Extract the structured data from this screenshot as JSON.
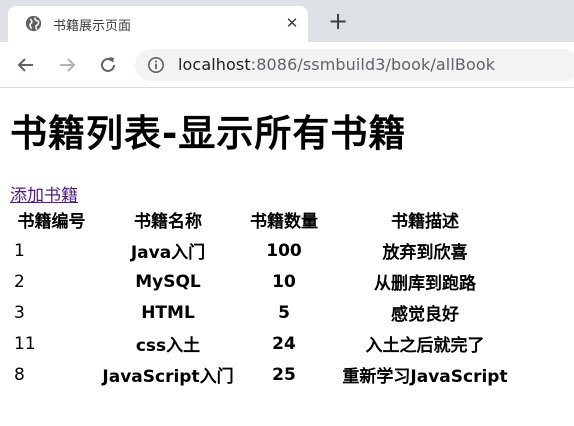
{
  "browser": {
    "tab_title": "书籍展示页面",
    "url_host": "localhost",
    "url_path": ":8086/ssmbuild3/book/allBook",
    "icons": {
      "favicon": "globe-icon",
      "close": "close-icon",
      "new_tab": "plus-icon",
      "back": "back-arrow-icon",
      "forward": "forward-arrow-icon",
      "reload": "reload-icon",
      "site_info": "info-icon"
    }
  },
  "page": {
    "heading": "书籍列表-显示所有书籍",
    "add_link": "添加书籍",
    "link_color": "#551a8b",
    "table": {
      "headers": [
        "书籍编号",
        "书籍名称",
        "书籍数量",
        "书籍描述"
      ],
      "rows": [
        [
          "1",
          "Java入门",
          "100",
          "放弃到欣喜"
        ],
        [
          "2",
          "MySQL",
          "10",
          "从删库到跑路"
        ],
        [
          "3",
          "HTML",
          "5",
          "感觉良好"
        ],
        [
          "11",
          "css入土",
          "24",
          "入土之后就完了"
        ],
        [
          "8",
          "JavaScript入门",
          "25",
          "重新学习JavaScript"
        ]
      ]
    }
  }
}
